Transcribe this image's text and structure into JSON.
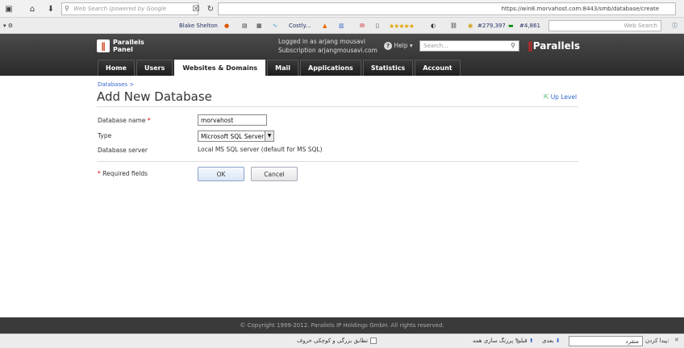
{
  "browser": {
    "search_placeholder": "Web Search (powered by Google",
    "url": "https://win8.morvahost.com:8443/smb/database/create",
    "url_host": "win8.morvahost.com"
  },
  "toolbar": {
    "blake": "Blake Shelton",
    "costly": "Costly...",
    "count1": "#279,397",
    "count2": "#4,861",
    "web_search": "Web Search"
  },
  "header": {
    "logo_line1": "Parallels",
    "logo_line2": "Panel",
    "logged_in": "Logged in as arjang mousavi",
    "subscription": "Subscription arjangmousavi.com",
    "help": "Help",
    "search_placeholder": "Search...",
    "brand": "Parallels"
  },
  "tabs": [
    {
      "label": "Home"
    },
    {
      "label": "Users"
    },
    {
      "label": "Websites & Domains"
    },
    {
      "label": "Mail"
    },
    {
      "label": "Applications"
    },
    {
      "label": "Statistics"
    },
    {
      "label": "Account"
    }
  ],
  "page": {
    "breadcrumb": "Databases >",
    "title": "Add New Database",
    "up_level": "Up Level",
    "db_name_label": "Database name",
    "db_name_value": "morvahost",
    "type_label": "Type",
    "type_value": "Microsoft SQL Server",
    "server_label": "Database server",
    "server_value": "Local MS SQL server (default for MS SQL)",
    "required_label": "Required fields",
    "ok": "OK",
    "cancel": "Cancel"
  },
  "footer": {
    "copyright": "© Copyright 1999-2012. Parallels IP Holdings GmbH. All rights reserved."
  },
  "findbar": {
    "find_label": "پیدا کردن:",
    "find_value": "متفرد",
    "next": "بعدی",
    "prev": "قبلی",
    "highlight": "پررنگ سازی همه",
    "match_case": "تطابق بزرگی و کوچکی حروف"
  },
  "colors": {
    "header_bg": "#2a2a2a",
    "brand_red": "#dd2222",
    "link_blue": "#3366cc"
  }
}
